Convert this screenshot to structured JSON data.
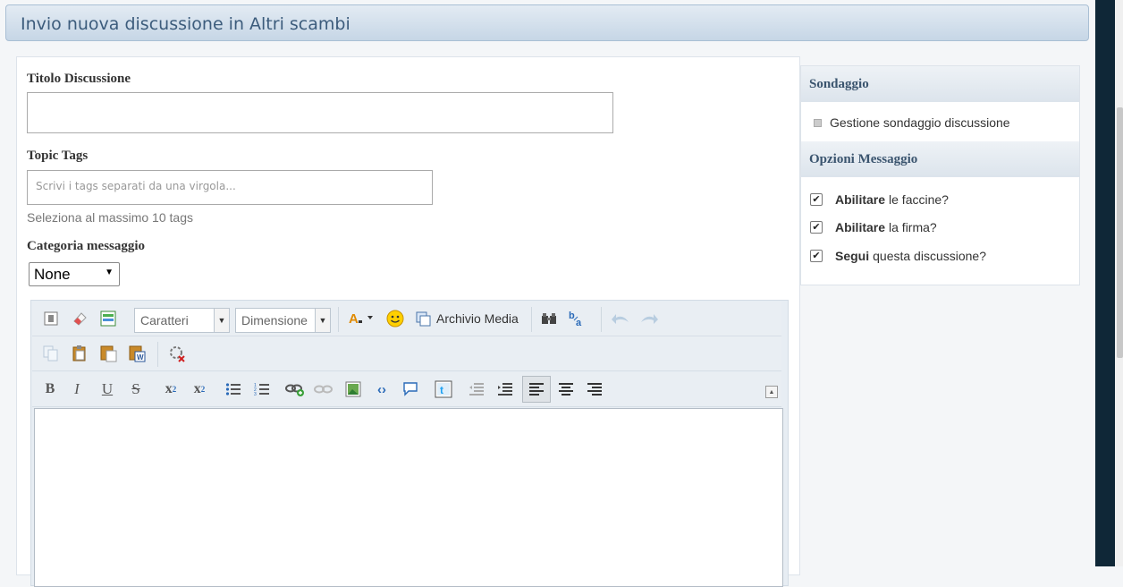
{
  "header": {
    "title": "Invio nuova discussione in Altri scambi"
  },
  "form": {
    "title_label": "Titolo Discussione",
    "title_value": "",
    "tags_label": "Topic Tags",
    "tags_placeholder": "Scrivi i tags separati da una virgola...",
    "tags_hint": "Seleziona al massimo 10 tags",
    "category_label": "Categoria messaggio",
    "category_selected": "None"
  },
  "editor": {
    "font_combo": "Caratteri",
    "size_combo": "Dimensione",
    "media_label": "Archivio Media",
    "toolbar_row1_icons": [
      "source-icon",
      "eraser-icon",
      "table-icon",
      "font-color-icon",
      "smiley-icon",
      "media-archive-icon",
      "find-icon",
      "replace-icon",
      "undo-icon",
      "redo-icon"
    ],
    "toolbar_row2_icons": [
      "copy-icon",
      "paste-icon",
      "paste-text-icon",
      "paste-word-icon",
      "remove-format-icon"
    ],
    "toolbar_row3_icons": [
      "bold-icon",
      "italic-icon",
      "underline-icon",
      "strikethrough-icon",
      "subscript-icon",
      "superscript-icon",
      "bulleted-list-icon",
      "numbered-list-icon",
      "link-icon",
      "unlink-icon",
      "image-icon",
      "code-icon",
      "quote-icon",
      "twitter-icon",
      "outdent-icon",
      "indent-icon",
      "align-left-icon",
      "align-center-icon",
      "align-right-icon",
      "collapse-toolbar-icon"
    ],
    "content": ""
  },
  "sidebar": {
    "poll_heading": "Sondaggio",
    "poll_link": "Gestione sondaggio discussione",
    "options_heading": "Opzioni Messaggio",
    "options": [
      {
        "bold": "Abilitare",
        "rest": "le faccine?",
        "checked": true
      },
      {
        "bold": "Abilitare",
        "rest": "la firma?",
        "checked": true
      },
      {
        "bold": "Segui",
        "rest": "questa discussione?",
        "checked": true
      }
    ]
  }
}
